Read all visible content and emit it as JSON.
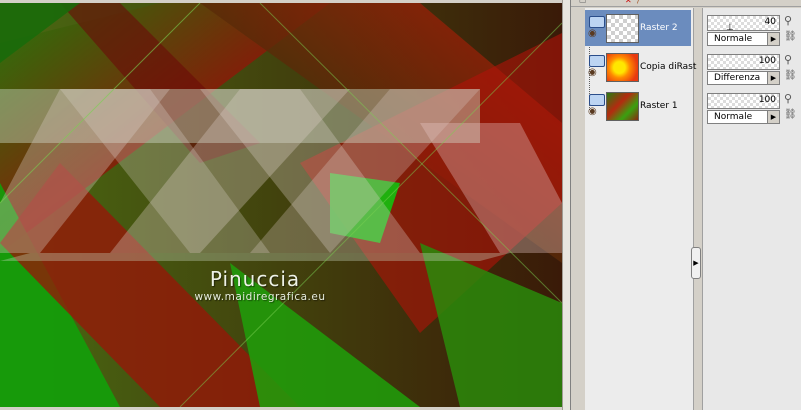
{
  "canvas": {
    "watermark_name": "Pinuccia",
    "watermark_url": "www.maidiregrafica.eu"
  },
  "layers": [
    {
      "name": "Raster 2",
      "thumbnail": "checker-transparent",
      "selected": true,
      "visible": true,
      "opacity": "40",
      "blend_mode": "Normale"
    },
    {
      "name": "Copia diRast",
      "thumbnail": "orange-yellow",
      "selected": false,
      "visible": true,
      "opacity": "100",
      "blend_mode": "Differenza"
    },
    {
      "name": "Raster 1",
      "thumbnail": "green-red",
      "selected": false,
      "visible": true,
      "opacity": "100",
      "blend_mode": "Normale"
    }
  ],
  "icons": {
    "visibility": "eye-icon",
    "layer_type": "raster-layer-icon",
    "lock": "lock-icon",
    "link": "link-icon",
    "dropdown": "chevron-down-icon",
    "collapse": "chevron-right-icon"
  },
  "colors": {
    "selected_row": "#6b8cbe",
    "panel_bg": "#d4d0c8"
  }
}
